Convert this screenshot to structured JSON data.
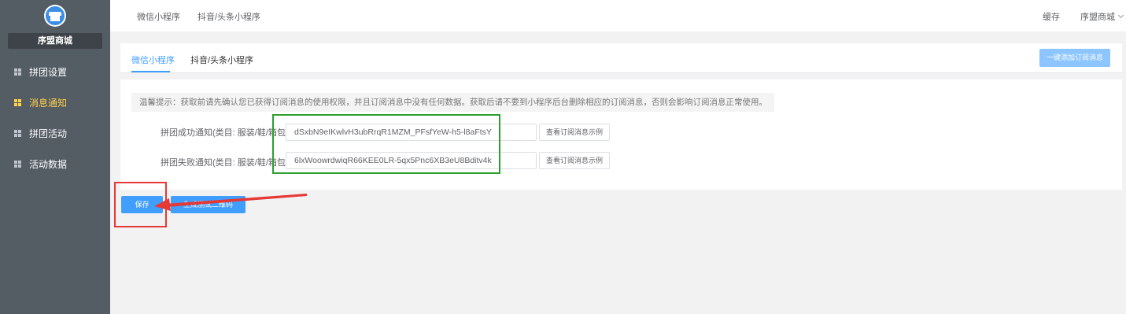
{
  "sidebar": {
    "shop_name": "序盟商城",
    "items": [
      {
        "label": "拼团设置",
        "active": false
      },
      {
        "label": "消息通知",
        "active": true
      },
      {
        "label": "拼团活动",
        "active": false
      },
      {
        "label": "活动数据",
        "active": false
      }
    ]
  },
  "topbar": {
    "links": [
      "微信小程序",
      "抖音/头条小程序"
    ],
    "cache": "缓存",
    "user": "序盟商城"
  },
  "tabs": [
    "微信小程序",
    "抖音/头条小程序"
  ],
  "add_button": "一键添加订阅消息",
  "tip": "温馨提示：获取前请先确认您已获得订阅消息的使用权限，并且订阅消息中没有任何数据。获取后请不要到小程序后台删除相应的订阅消息，否则会影响订阅消息正常使用。",
  "rows": [
    {
      "label": "拼团成功通知(类目: 服装/鞋/箱包）",
      "value": "dSxbN9eIKwlvH3ubRrqR1MZM_PFsfYeW-h5-l8aFtsY",
      "example": "查看订阅消息示例"
    },
    {
      "label": "拼团失败通知(类目: 服装/鞋/箱包）",
      "value": "6lxWoowrdwiqR66KEE0LR-5qx5Pnc6XB3eU8Bditv4k",
      "example": "查看订阅消息示例"
    }
  ],
  "save_button": "保存",
  "qr_button": "生成测试二维码",
  "colors": {
    "sidebar_bg": "#545c64",
    "active_menu": "#ffd04b",
    "primary": "#409eff",
    "annotation_green": "#2ca02c",
    "annotation_red": "#e53935"
  }
}
